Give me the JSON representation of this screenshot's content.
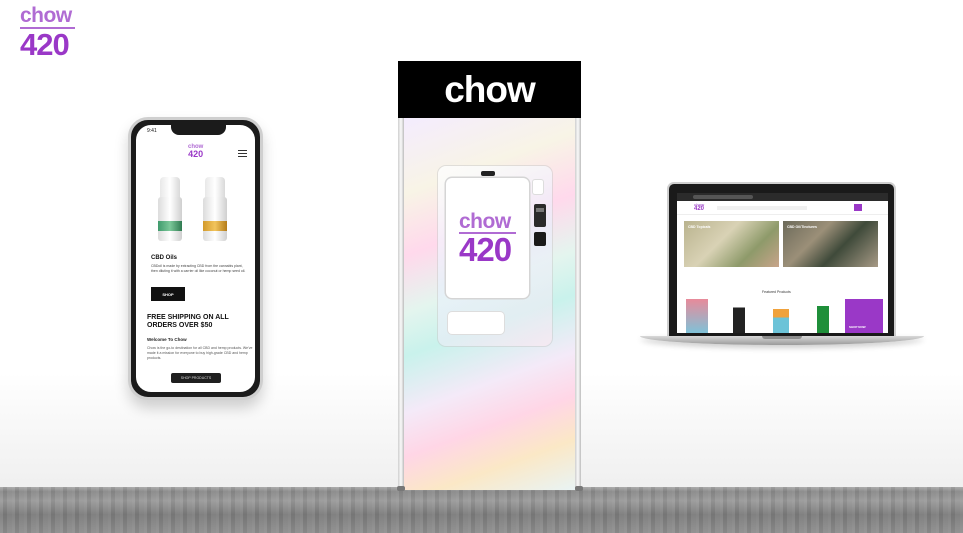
{
  "brand": {
    "wordmark": "chow",
    "number": "420"
  },
  "phone": {
    "time": "9:41",
    "logo_word": "chow",
    "logo_num": "420",
    "product_title": "CBD Oils",
    "product_text": "CBDoil is made by extracting CBD from the cannabis plant, then diluting it with a carrier oil like coconut or hemp seed oil.",
    "shop_label": "SHOP",
    "shipping_headline": "FREE SHIPPING ON ALL ORDERS OVER $50",
    "welcome": "Welcome To Chow",
    "welcome_text": "Chow is the go-to destination for all CBD and hemp products. We've made it a mission for everyone to buy high-grade CBD and hemp products.",
    "bottom_button": "SHOP PRODUCTS"
  },
  "kiosk": {
    "header": "chow",
    "screen_word": "chow",
    "screen_num": "420"
  },
  "laptop": {
    "logo_word": "chow",
    "logo_num": "420",
    "tile1_label": "CBD Topicals",
    "tile2_label": "CBD Oil/Tinctures",
    "section_title": "Featured Products",
    "promo_label": "SHOP NOW"
  },
  "colors": {
    "brand_purple": "#9a38c7",
    "kiosk_black": "#000000"
  }
}
